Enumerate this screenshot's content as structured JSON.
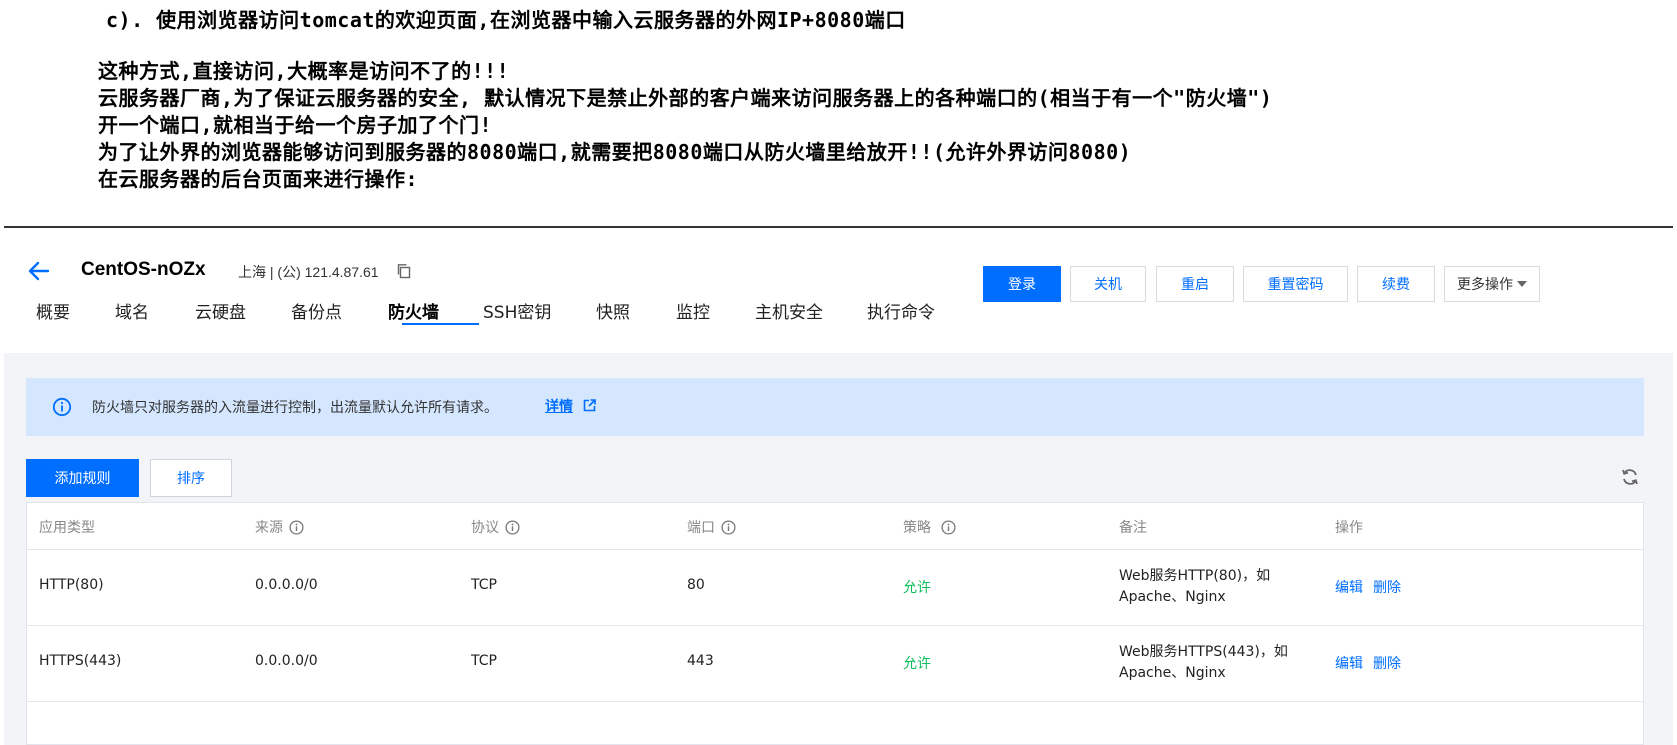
{
  "notes": {
    "heading": "c). 使用浏览器访问tomcat的欢迎页面,在浏览器中输入云服务器的外网IP+8080端口",
    "lines": [
      "这种方式,直接访问,大概率是访问不了的!!!",
      "云服务器厂商,为了保证云服务器的安全, 默认情况下是禁止外部的客户端来访问服务器上的各种端口的(相当于有一个\"防火墙\")",
      "开一个端口,就相当于给一个房子加了个门!",
      "为了让外界的浏览器能够访问到服务器的8080端口,就需要把8080端口从防火墙里给放开!!(允许外界访问8080)",
      "在云服务器的后台页面来进行操作:"
    ]
  },
  "header": {
    "server_name": "CentOS-nOZx",
    "server_meta": "上海 | (公) 121.4.87.61",
    "buttons": {
      "login": "登录",
      "shutdown": "关机",
      "restart": "重启",
      "reset_password": "重置密码",
      "renew": "续费",
      "more": "更多操作"
    }
  },
  "tabs": [
    "概要",
    "域名",
    "云硬盘",
    "备份点",
    "防火墙",
    "SSH密钥",
    "快照",
    "监控",
    "主机安全",
    "执行命令"
  ],
  "active_tab": "防火墙",
  "banner": {
    "text": "防火墙只对服务器的入流量进行控制，出流量默认允许所有请求。",
    "link": "详情"
  },
  "toolbar": {
    "add_rule": "添加规则",
    "sort": "排序"
  },
  "table": {
    "columns": [
      "应用类型",
      "来源",
      "协议",
      "端口",
      "策略",
      "备注",
      "操作"
    ],
    "rows": [
      {
        "type": "HTTP(80)",
        "source": "0.0.0.0/0",
        "protocol": "TCP",
        "port": "80",
        "policy": "允许",
        "note_line1": "Web服务HTTP(80)，如",
        "note_line2": "Apache、Nginx",
        "edit": "编辑",
        "delete": "删除"
      },
      {
        "type": "HTTPS(443)",
        "source": "0.0.0.0/0",
        "protocol": "TCP",
        "port": "443",
        "policy": "允许",
        "note_line1": "Web服务HTTPS(443)，如",
        "note_line2": "Apache、Nginx",
        "edit": "编辑",
        "delete": "删除"
      }
    ]
  },
  "colors": {
    "accent": "#006eff",
    "allow": "#0abf5b",
    "banner_bg": "#d5e7ff",
    "content_bg": "#f3f4f7"
  }
}
